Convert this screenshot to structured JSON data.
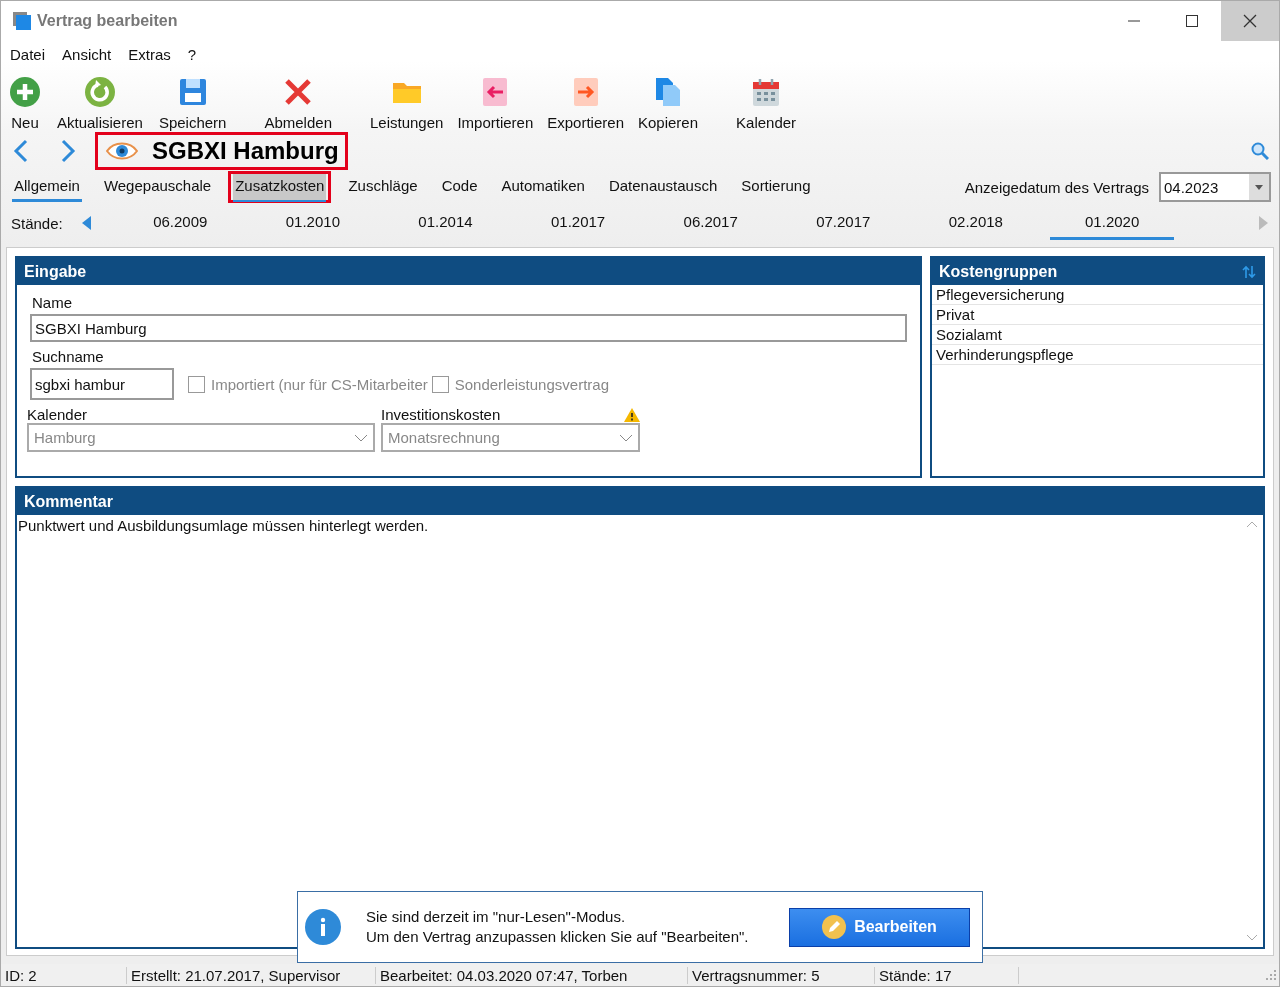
{
  "window": {
    "title": "Vertrag bearbeiten"
  },
  "menu": [
    "Datei",
    "Ansicht",
    "Extras",
    "?"
  ],
  "toolbar": [
    {
      "label": "Neu",
      "kind": "add"
    },
    {
      "label": "Aktualisieren",
      "kind": "refresh"
    },
    {
      "label": "Speichern",
      "kind": "save"
    },
    {
      "label": "Abmelden",
      "kind": "close"
    },
    {
      "label": "Leistungen",
      "kind": "folder"
    },
    {
      "label": "Importieren",
      "kind": "import"
    },
    {
      "label": "Exportieren",
      "kind": "export"
    },
    {
      "label": "Kopieren",
      "kind": "copy"
    },
    {
      "label": "Kalender",
      "kind": "calendar"
    }
  ],
  "record": {
    "title": "SGBXI Hamburg",
    "highlighted": true
  },
  "tabs": [
    {
      "label": "Allgemein",
      "selected": true,
      "hovered": false,
      "highlighted": false
    },
    {
      "label": "Wegepauschale",
      "selected": false,
      "hovered": false,
      "highlighted": false
    },
    {
      "label": "Zusatzkosten",
      "selected": false,
      "hovered": true,
      "highlighted": true
    },
    {
      "label": "Zuschläge",
      "selected": false,
      "hovered": false,
      "highlighted": false
    },
    {
      "label": "Code",
      "selected": false,
      "hovered": false,
      "highlighted": false
    },
    {
      "label": "Automatiken",
      "selected": false,
      "hovered": false,
      "highlighted": false
    },
    {
      "label": "Datenaustausch",
      "selected": false,
      "hovered": false,
      "highlighted": false
    },
    {
      "label": "Sortierung",
      "selected": false,
      "hovered": false,
      "highlighted": false
    }
  ],
  "display_date": {
    "label": "Anzeigedatum des Vertrags",
    "value": "04.2023"
  },
  "versions": {
    "label": "Stände:",
    "items": [
      {
        "label": "06.2009",
        "selected": false
      },
      {
        "label": "01.2010",
        "selected": false
      },
      {
        "label": "01.2014",
        "selected": false
      },
      {
        "label": "01.2017",
        "selected": false
      },
      {
        "label": "06.2017",
        "selected": false
      },
      {
        "label": "07.2017",
        "selected": false
      },
      {
        "label": "02.2018",
        "selected": false
      },
      {
        "label": "01.2020",
        "selected": true
      }
    ]
  },
  "input_panel": {
    "title": "Eingabe",
    "name": {
      "label": "Name",
      "value": "SGBXI Hamburg"
    },
    "search_name": {
      "label": "Suchname",
      "value": "sgbxi hambur"
    },
    "checkboxes": [
      {
        "label": "Importiert (nur für CS-Mitarbeiter",
        "checked": false,
        "disabled": true
      },
      {
        "label": "Sonderleistungsvertrag",
        "checked": false,
        "disabled": true
      }
    ],
    "calendar": {
      "label": "Kalender",
      "value": "Hamburg"
    },
    "investment": {
      "label": "Investitionskosten",
      "value": "Monatsrechnung",
      "warning": true
    }
  },
  "cost_groups": {
    "title": "Kostengruppen",
    "items": [
      "Pflegeversicherung",
      "Privat",
      "Sozialamt",
      "Verhinderungspflege"
    ]
  },
  "comment": {
    "title": "Kommentar",
    "text": "Punktwert und Ausbildungsumlage müssen hinterlegt werden."
  },
  "notice": {
    "lines": [
      "Sie sind derzeit im \"nur-Lesen\"-Modus.",
      "Um den Vertrag anzupassen klicken Sie auf \"Bearbeiten\"."
    ],
    "button": "Bearbeiten"
  },
  "status_bar": [
    "ID: 2",
    "Erstellt: 21.07.2017, Supervisor",
    "Bearbeitet: 04.03.2020 07:47, Torben",
    "Vertragsnummer: 5",
    "Stände: 17"
  ]
}
